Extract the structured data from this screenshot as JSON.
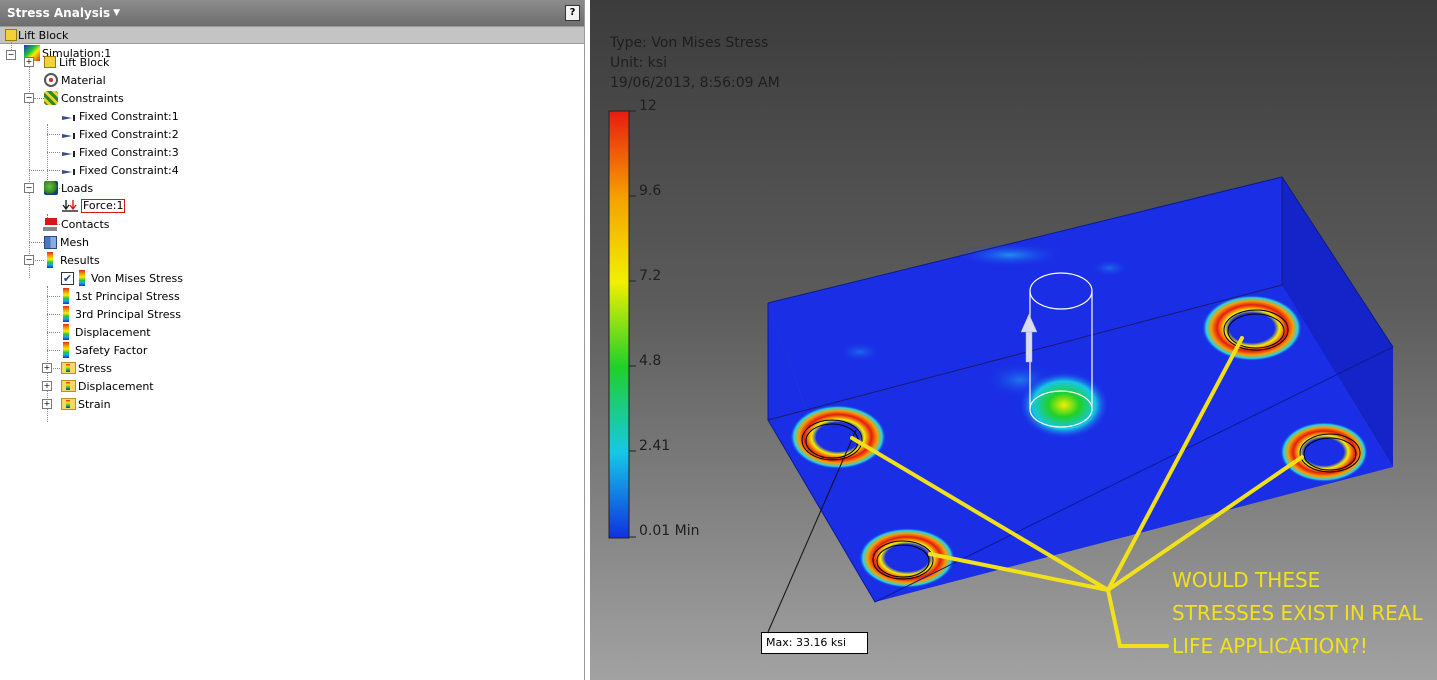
{
  "browser": {
    "title": "Stress Analysis",
    "help_label": "?",
    "root": "Lift Block",
    "tree": {
      "simulation": "Simulation:1",
      "part": "Lift Block",
      "material": "Material",
      "constraints": "Constraints",
      "fixed": [
        "Fixed Constraint:1",
        "Fixed Constraint:2",
        "Fixed Constraint:3",
        "Fixed Constraint:4"
      ],
      "loads": "Loads",
      "force": "Force:1",
      "contacts": "Contacts",
      "mesh": "Mesh",
      "results": "Results",
      "result_items": [
        "Von Mises Stress",
        "1st Principal Stress",
        "3rd Principal Stress",
        "Displacement",
        "Safety Factor"
      ],
      "folders": [
        "Stress",
        "Displacement",
        "Strain"
      ]
    }
  },
  "viewport": {
    "type_line": "Type: Von Mises Stress",
    "unit_line": "Unit: ksi",
    "date_line": "19/06/2013, 8:56:09 AM",
    "legend_ticks": [
      "12",
      "9.6",
      "7.2",
      "4.8",
      "2.41",
      "0.01 Min"
    ],
    "max_label": "Max: 33.16 ksi",
    "callout": [
      "WOULD THESE",
      "STRESSES EXIST IN REAL",
      "LIFE APPLICATION?!"
    ]
  },
  "colors": {
    "callout": "#f1e11a",
    "part_blue": "#1a2ee6",
    "stress_red": "#e81a12"
  }
}
